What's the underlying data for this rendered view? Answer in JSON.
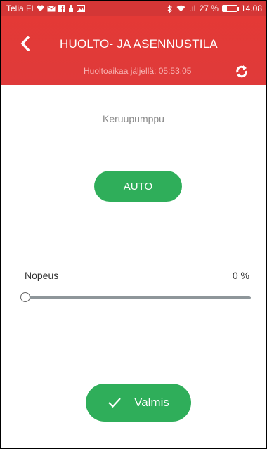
{
  "status_bar": {
    "carrier": "Telia FI",
    "signal": ".ıl",
    "battery_percent": "27 %",
    "battery_level": 0.27,
    "time": "14.08",
    "icons": [
      "heart-icon",
      "mail-icon",
      "facebook-icon",
      "person-icon",
      "image-icon",
      "bluetooth-icon",
      "wifi-icon"
    ]
  },
  "header": {
    "title": "HUOLTO- JA ASENNUSTILA",
    "subtitle": "Huoltoaikaa jäljellä: 05:53:05",
    "back_icon": "chevron-left-icon",
    "refresh_icon": "refresh-icon"
  },
  "main": {
    "device_label": "Keruupumppu",
    "mode_button_label": "AUTO",
    "speed_label": "Nopeus",
    "speed_value": "0 %",
    "speed_fraction": 0,
    "done_button_label": "Valmis",
    "done_icon": "check-icon"
  },
  "colors": {
    "header_red": "#e53935",
    "accent_green": "#2fae5a"
  }
}
